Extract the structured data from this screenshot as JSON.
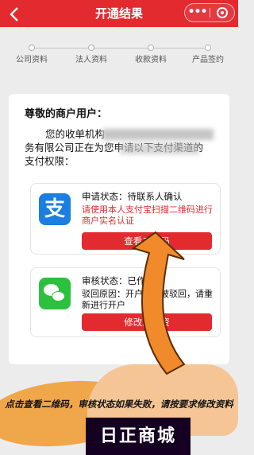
{
  "header": {
    "title": "开通结果",
    "back_icon": "chevron-left-icon",
    "more_label": "•••"
  },
  "steps": [
    {
      "label": "公司资料"
    },
    {
      "label": "法人资料"
    },
    {
      "label": "收款资料"
    },
    {
      "label": "产品签约"
    }
  ],
  "card": {
    "greeting": "尊敬的商户用户：",
    "line1": "您的收单机构",
    "line2": "务有限公司正在为您申请以下支付渠道的",
    "line3": "支付权限："
  },
  "channels": [
    {
      "icon": "alipay-icon",
      "icon_char": "支",
      "status": "申请状态：待联系人确认",
      "note": "请使用本人支付宝扫描二维码进行商户实名认证",
      "button": "查看二维码"
    },
    {
      "icon": "wechat-icon",
      "status": "审核状态：已作",
      "note": "驳回原因：开户申请被驳回，请重新进行开户",
      "button": "修改商户资"
    }
  ],
  "caption": "点击查看二维码，审核状态如果失败，请按要求修改资料",
  "brand": "日正商城",
  "colors": {
    "primary": "#e22a2f",
    "alipay": "#1a7fe0",
    "wechat": "#2cc03f",
    "arrow": "#f08a2a"
  }
}
